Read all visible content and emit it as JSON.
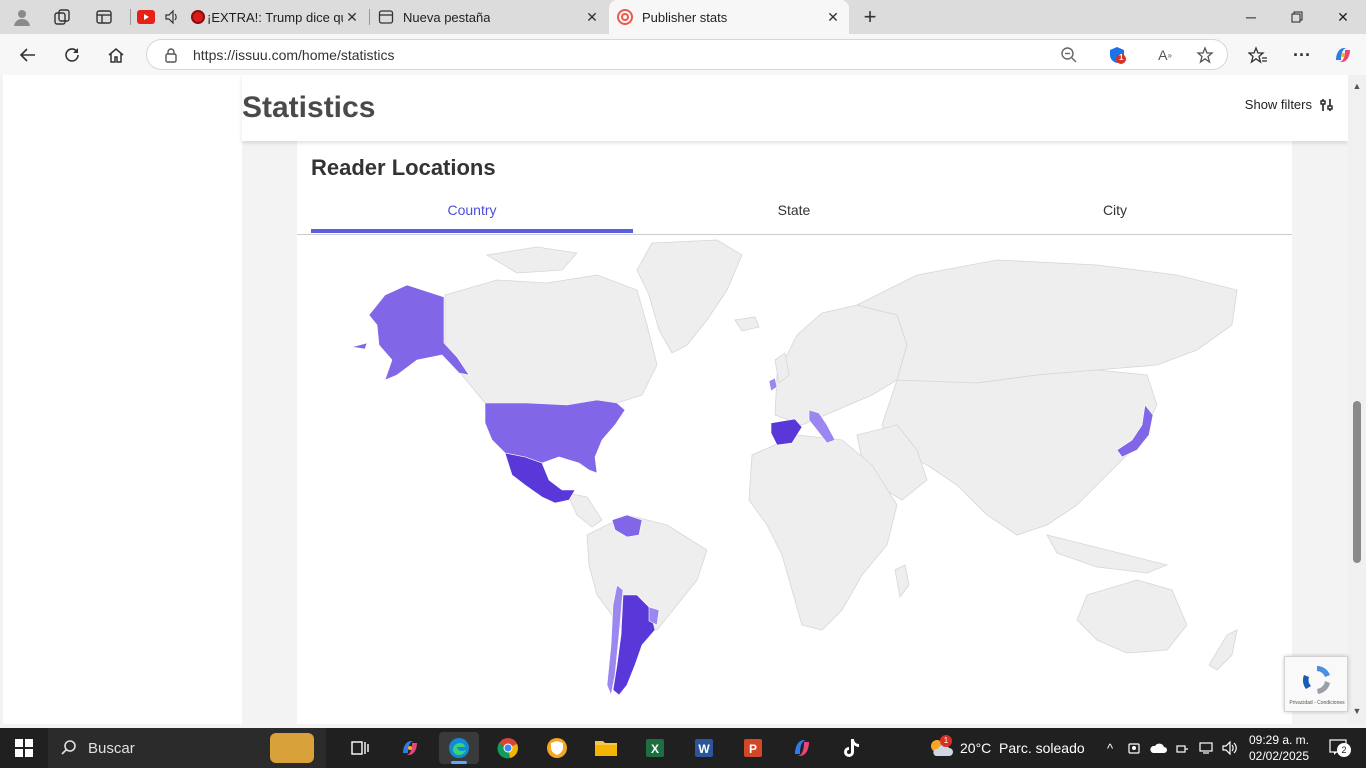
{
  "browser": {
    "tabs": [
      {
        "title": "¡EXTRA!: Trump dice que el",
        "icon": "live-red-dot-icon"
      },
      {
        "title": "Nueva pestaña",
        "icon": "new-tab-page-icon"
      },
      {
        "title": "Publisher stats",
        "icon": "issuu-logo-icon",
        "active": true
      }
    ],
    "url": "https://issuu.com/home/statistics",
    "extension_badge": "1"
  },
  "page": {
    "title": "Statistics",
    "show_filters_label": "Show filters",
    "section_title": "Reader Locations",
    "location_tabs": [
      {
        "label": "Country",
        "active": true
      },
      {
        "label": "State",
        "active": false
      },
      {
        "label": "City",
        "active": false
      }
    ],
    "recaptcha_label": "Privacidad - Condiciones"
  },
  "map": {
    "base_color": "#eeeeee",
    "border_color": "#d8d8d8",
    "highlight_colors": {
      "light": "#9b87ef",
      "medium": "#8266e8",
      "dark": "#5a37d9"
    },
    "highlighted_regions": [
      "Alaska (United States)",
      "United States",
      "Mexico",
      "Venezuela",
      "Argentina",
      "Chile",
      "Uruguay",
      "Spain",
      "Italy",
      "Ireland",
      "Japan"
    ]
  },
  "taskbar": {
    "search_placeholder": "Buscar",
    "weather": "20°C  Parc. soleado",
    "weather_badge": "1",
    "time": "09:29 a. m.",
    "date": "02/02/2025",
    "notification_count": "2"
  }
}
